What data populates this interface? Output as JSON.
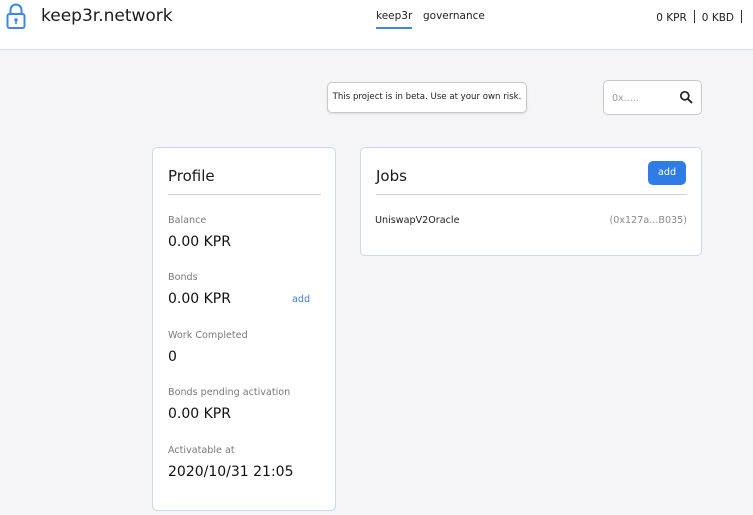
{
  "header": {
    "title": "keep3r.network",
    "nav": [
      {
        "label": "keep3r",
        "active": true
      },
      {
        "label": "governance",
        "active": false
      }
    ],
    "balances": {
      "kpr": "0 KPR",
      "kbd": "0 KBD"
    },
    "lock_icon": "lock-icon"
  },
  "banner": {
    "text": "This project is in beta. Use at your own risk."
  },
  "search": {
    "placeholder": "0x.....",
    "value": "",
    "icon": "search-icon"
  },
  "profile": {
    "title": "Profile",
    "balance": {
      "label": "Balance",
      "value": "0.00 KPR"
    },
    "bonds": {
      "label": "Bonds",
      "value": "0.00 KPR",
      "add_label": "add"
    },
    "work": {
      "label": "Work Completed",
      "value": "0"
    },
    "pending": {
      "label": "Bonds pending activation",
      "value": "0.00 KPR"
    },
    "activatable": {
      "label": "Activatable at",
      "value": "2020/10/31 21:05"
    }
  },
  "jobs": {
    "title": "Jobs",
    "add_label": "add",
    "items": [
      {
        "name": "UniswapV2Oracle",
        "address": "(0x127a...B035)"
      }
    ]
  },
  "colors": {
    "accent": "#2f7ce8",
    "border": "#c5d9f1",
    "background": "#f5f5f7"
  }
}
